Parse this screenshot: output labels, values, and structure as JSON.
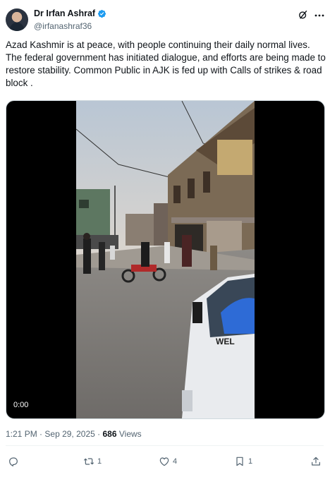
{
  "author": {
    "display_name": "Dr Irfan Ashraf",
    "handle": "@irfanashraf36",
    "verified": true
  },
  "tweet": {
    "text": "Azad Kashmir is at peace, with people continuing their daily normal lives. The federal government has initiated dialogue, and efforts are being made to restore stability. Common Public in AJK is fed up with Calls of strikes & road block ."
  },
  "video": {
    "timestamp": "0:00"
  },
  "meta": {
    "time": "1:21 PM",
    "separator": "·",
    "date": "Sep 29, 2025",
    "views_count": "686",
    "views_label": "Views"
  },
  "actions": {
    "reply_count": "",
    "repost_count": "1",
    "like_count": "4",
    "bookmark_count": "1"
  },
  "icons": {
    "verified": "verified-badge-icon",
    "grok": "grok-icon",
    "more": "more-icon",
    "reply": "reply-icon",
    "repost": "repost-icon",
    "like": "heart-icon",
    "bookmark": "bookmark-icon",
    "share": "share-icon"
  },
  "colors": {
    "verified_blue": "#1d9bf0",
    "text_primary": "#0f1419",
    "text_secondary": "#536471"
  }
}
